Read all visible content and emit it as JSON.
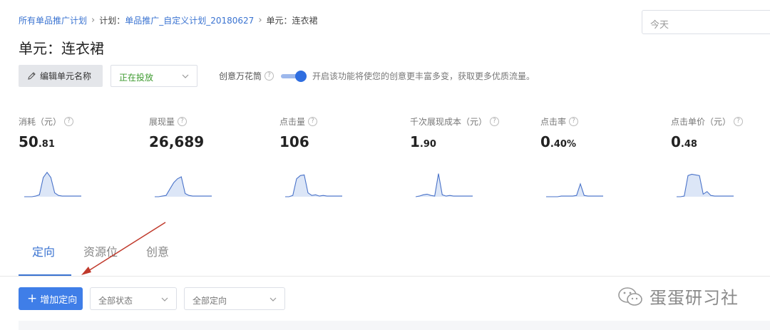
{
  "breadcrumb": {
    "root": "所有单品推广计划",
    "plan_prefix": "计划：",
    "plan_name": "单品推广_自定义计划_20180627",
    "unit": "单元：连衣裙"
  },
  "date_picker": {
    "value": "今天"
  },
  "page_title": "单元：连衣裙",
  "toolbar": {
    "edit_label": "编辑单元名称",
    "status_value": "正在投放"
  },
  "kaleidoscope": {
    "label": "创意万花筒",
    "description": "开启该功能将使您的创意更丰富多变，获取更多优质流量。",
    "enabled": true
  },
  "metrics": [
    {
      "label": "消耗（元）",
      "int": "50",
      "dec": ".81",
      "spark": [
        0,
        0,
        0,
        1,
        3,
        30,
        38,
        30,
        6,
        2,
        1,
        1,
        1,
        1,
        1,
        1
      ]
    },
    {
      "label": "展现量",
      "int": "26,689",
      "dec": "",
      "spark": [
        0,
        0,
        1,
        2,
        12,
        22,
        28,
        31,
        5,
        2,
        1,
        1,
        1,
        1,
        1,
        1
      ]
    },
    {
      "label": "点击量",
      "int": "106",
      "dec": "",
      "spark": [
        0,
        0,
        2,
        28,
        33,
        34,
        6,
        2,
        3,
        1,
        2,
        1,
        1,
        1,
        1,
        1
      ]
    },
    {
      "label": "千次展现成本（元）",
      "int": "1",
      "dec": ".90",
      "spark": [
        0,
        1,
        3,
        4,
        2,
        1,
        36,
        3,
        1,
        2,
        1,
        1,
        1,
        1,
        1,
        1
      ]
    },
    {
      "label": "点击率",
      "int": "0",
      "dec": ".40%",
      "spark": [
        0,
        0,
        0,
        0,
        1,
        1,
        1,
        1,
        2,
        20,
        2,
        1,
        1,
        1,
        1,
        1
      ]
    },
    {
      "label": "点击单价（元）",
      "int": "0",
      "dec": ".48",
      "spark": [
        0,
        0,
        1,
        33,
        35,
        34,
        33,
        4,
        8,
        2,
        1,
        1,
        1,
        1,
        1,
        1
      ]
    }
  ],
  "tabs": [
    {
      "label": "定向",
      "active": true
    },
    {
      "label": "资源位",
      "active": false
    },
    {
      "label": "创意",
      "active": false
    }
  ],
  "actions": {
    "add_label": "增加定向",
    "state_filter": "全部状态",
    "target_filter": "全部定向"
  },
  "watermark": "蛋蛋研习社",
  "colors": {
    "accent": "#3a73d1",
    "status_green": "#3d9a2f",
    "spark_fill": "#dce6f7",
    "spark_stroke": "#4a73c9",
    "arrow": "#c0392b"
  }
}
